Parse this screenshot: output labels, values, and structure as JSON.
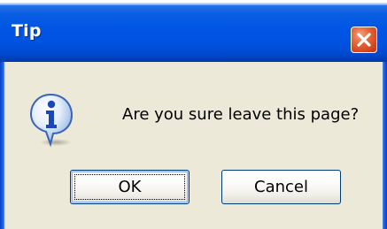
{
  "dialog": {
    "title": "Tip",
    "message": "Are you sure leave this page?",
    "icon": "information-icon",
    "close_icon": "close-icon"
  },
  "buttons": {
    "ok_label": "OK",
    "cancel_label": "Cancel"
  },
  "colors": {
    "titlebar": "#0055e5",
    "close_button": "#d2451e",
    "dialog_background": "#ece9d8",
    "focus_ring": "#94b2f2"
  }
}
